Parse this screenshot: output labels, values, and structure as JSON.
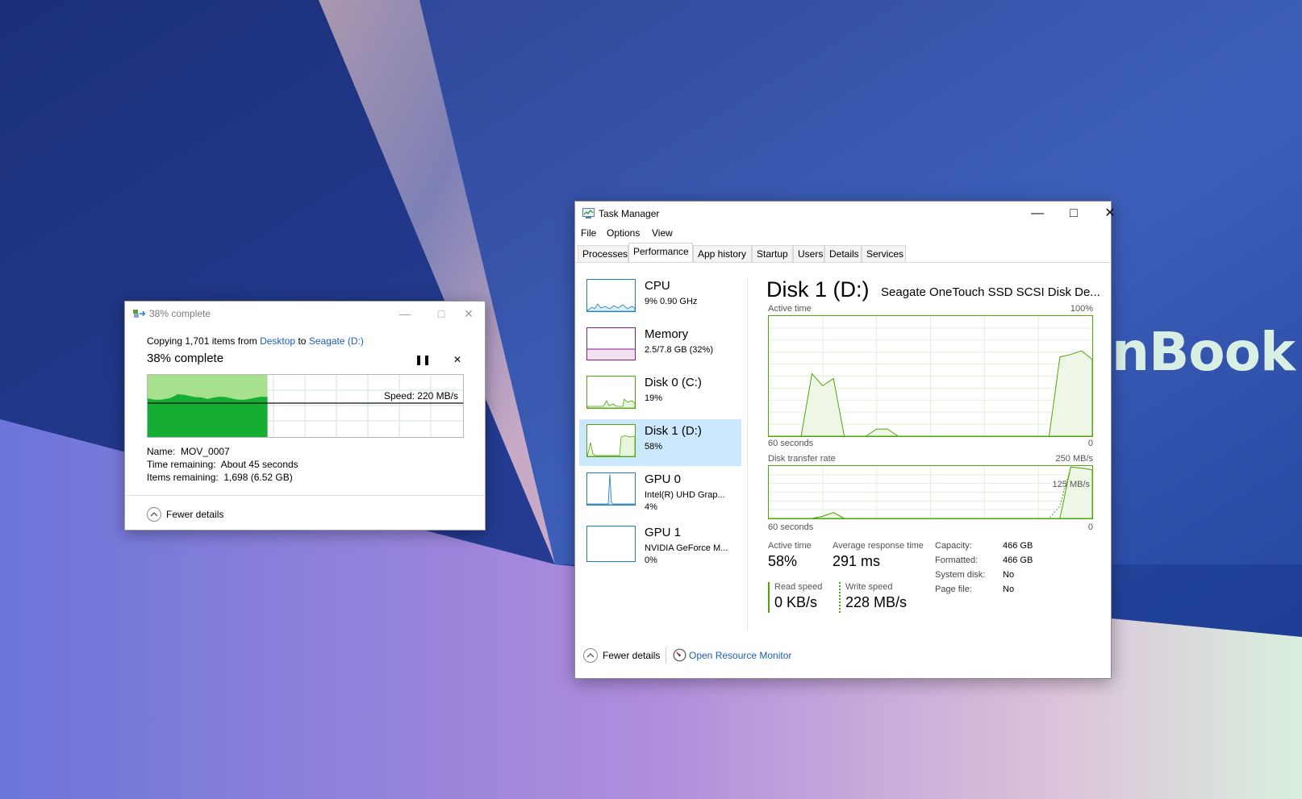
{
  "wallpaper": {
    "brand_text": "nBook"
  },
  "copy_dialog": {
    "title": "38% complete",
    "copying_prefix": "Copying 1,701 items from",
    "from_link": "Desktop",
    "to_word": "to",
    "to_link": "Seagate (D:)",
    "percent_label": "38% complete",
    "progress": 0.38,
    "speed": "Speed: 220 MB/s",
    "name_label": "Name:",
    "name_value": "MOV_0007",
    "time_label": "Time remaining:",
    "time_value": "About 45 seconds",
    "items_label": "Items remaining:",
    "items_value": "1,698 (6.52 GB)",
    "fewer_details": "Fewer details"
  },
  "task_manager": {
    "title": "Task Manager",
    "menu": [
      "File",
      "Options",
      "View"
    ],
    "tabs": [
      "Processes",
      "Performance",
      "App history",
      "Startup",
      "Users",
      "Details",
      "Services"
    ],
    "active_tab": "Performance",
    "sidebar": [
      {
        "name": "CPU",
        "sub1": "9%  0.90 GHz",
        "sub2": "",
        "color": "#1a7dbf"
      },
      {
        "name": "Memory",
        "sub1": "2.5/7.8 GB (32%)",
        "sub2": "",
        "color": "#8b1a8b"
      },
      {
        "name": "Disk 0 (C:)",
        "sub1": "19%",
        "sub2": "",
        "color": "#4da60c"
      },
      {
        "name": "Disk 1 (D:)",
        "sub1": "58%",
        "sub2": "",
        "color": "#4da60c"
      },
      {
        "name": "GPU 0",
        "sub1": "Intel(R) UHD Grap...",
        "sub2": "4%",
        "color": "#1a7dbf"
      },
      {
        "name": "GPU 1",
        "sub1": "NVIDIA GeForce M...",
        "sub2": "0%",
        "color": "#1a7dbf"
      }
    ],
    "selected_item": "Disk 1 (D:)",
    "disk_title": "Disk 1 (D:)",
    "disk_model": "Seagate OneTouch SSD SCSI Disk De...",
    "active_time_label": "Active time",
    "active_time_max": "100%",
    "seconds_label": "60 seconds",
    "zero": "0",
    "transfer_label": "Disk transfer rate",
    "transfer_max": "250 MB/s",
    "transfer_mid": "125 MB/s",
    "stats": {
      "active_time_label": "Active time",
      "active_time_value": "58%",
      "response_label": "Average response time",
      "response_value": "291 ms",
      "read_label": "Read speed",
      "read_value": "0 KB/s",
      "write_label": "Write speed",
      "write_value": "228 MB/s"
    },
    "info": [
      {
        "k": "Capacity:",
        "v": "466 GB"
      },
      {
        "k": "Formatted:",
        "v": "466 GB"
      },
      {
        "k": "System disk:",
        "v": "No"
      },
      {
        "k": "Page file:",
        "v": "No"
      }
    ],
    "footer": {
      "fewer_details": "Fewer details",
      "resource_monitor": "Open Resource Monitor"
    }
  },
  "chart_data": [
    {
      "type": "area",
      "title": "Active time",
      "xlabel": "60 seconds",
      "ylim": [
        0,
        100
      ],
      "x": [
        0,
        2,
        4,
        6,
        8,
        10,
        12,
        14,
        16,
        18,
        20,
        22,
        24,
        26,
        28,
        30,
        32,
        34,
        36,
        38,
        40,
        42,
        44,
        46,
        48,
        50,
        52,
        54,
        56,
        58,
        60
      ],
      "values": [
        0,
        0,
        0,
        0,
        52,
        42,
        48,
        0,
        0,
        0,
        6,
        6,
        0,
        0,
        0,
        0,
        0,
        0,
        0,
        0,
        0,
        0,
        0,
        0,
        0,
        0,
        0,
        66,
        68,
        71,
        64
      ]
    },
    {
      "type": "area",
      "title": "Disk transfer rate",
      "xlabel": "60 seconds",
      "ylim": [
        0,
        250
      ],
      "x": [
        0,
        2,
        4,
        6,
        8,
        10,
        12,
        14,
        16,
        18,
        20,
        22,
        24,
        26,
        28,
        30,
        32,
        34,
        36,
        38,
        40,
        42,
        44,
        46,
        48,
        50,
        52,
        54,
        56,
        58,
        60
      ],
      "values": [
        0,
        0,
        0,
        0,
        0,
        10,
        28,
        0,
        0,
        0,
        0,
        0,
        0,
        0,
        0,
        0,
        0,
        0,
        0,
        0,
        0,
        0,
        0,
        0,
        0,
        0,
        0,
        0,
        245,
        240,
        232
      ],
      "read_values": [
        0,
        0,
        0,
        0,
        0,
        0,
        0,
        0,
        0,
        0,
        0,
        0,
        0,
        0,
        0,
        0,
        0,
        0,
        0,
        0,
        0,
        0,
        0,
        0,
        0,
        0,
        0,
        0,
        0,
        0,
        0
      ],
      "write_values": [
        0,
        0,
        0,
        0,
        0,
        10,
        28,
        0,
        0,
        0,
        0,
        0,
        0,
        0,
        0,
        0,
        0,
        0,
        0,
        0,
        0,
        0,
        0,
        0,
        0,
        0,
        0,
        60,
        245,
        240,
        232
      ]
    }
  ]
}
